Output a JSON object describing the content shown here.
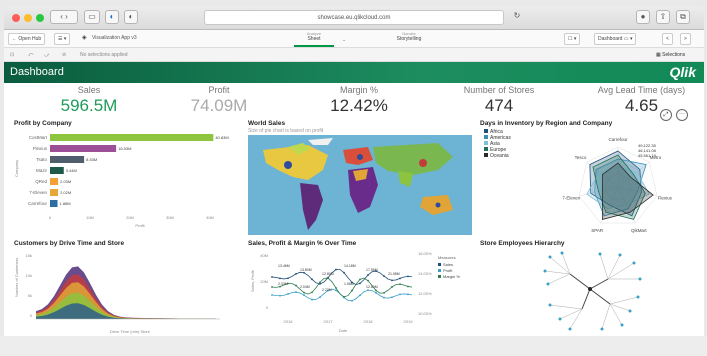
{
  "browser": {
    "url": "showcase.eu.qlikcloud.com"
  },
  "toolbar": {
    "open_hub": "Open Hub",
    "app_title": "Visualization App v3",
    "tab_analyze": "Analyze",
    "tab_sheet": "Sheet",
    "tab_narrate": "Narrate",
    "tab_storytelling": "Storytelling",
    "dashboard_btn": "Dashboard",
    "selections": "Selections",
    "no_selections": "No selections applied"
  },
  "header": {
    "title": "Dashboard",
    "logo": "Qlik"
  },
  "kpis": [
    {
      "label": "Sales",
      "value": "596.5M"
    },
    {
      "label": "Profit",
      "value": "74.09M"
    },
    {
      "label": "Margin %",
      "value": "12.42%"
    },
    {
      "label": "Number of Stores",
      "value": "474"
    },
    {
      "label": "Avg Lead Time (days)",
      "value": "4.65"
    }
  ],
  "panels": {
    "profit_by_company": "Profit by Company",
    "world_sales": "World Sales",
    "world_sub": "Size of pie chart is based on profit",
    "days_inventory": "Days in Inventory by Region and Company",
    "customers_drive": "Customers by Drive Time and Store",
    "sales_profit_margin": "Sales, Profit & Margin % Over Time",
    "store_employees": "Store Employees Hierarchy"
  },
  "chart_data": [
    {
      "type": "bar",
      "title": "Profit by Company",
      "ylabel": "Company",
      "xlabel": "Profit",
      "categories": [
        "CostMart",
        "Flexius",
        "Tsato",
        "Mazir",
        "QRed",
        "7-Eleven",
        "Carrefour"
      ],
      "values": [
        40.83,
        16.53,
        8.53,
        3.44,
        2.03,
        2.02,
        1.88
      ],
      "value_labels": [
        "40.83M",
        "16.53M",
        "8.53M",
        "3.44M",
        "2.03M",
        "2.02M",
        "1.88M"
      ],
      "colors": [
        "#8dc53e",
        "#9c4e96",
        "#4f5d6d",
        "#1e5a4c",
        "#f2a13a",
        "#e6a83b",
        "#2e6ca4"
      ],
      "xticks": [
        "0",
        "10M",
        "20M",
        "30M",
        "40M"
      ]
    },
    {
      "type": "line",
      "title": "Sales, Profit & Margin % Over Time",
      "xlabel": "Date",
      "ylabel": "Sales, Profit",
      "x": [
        "2016",
        "2017",
        "2018",
        "2019"
      ],
      "series": [
        {
          "name": "Sales"
        },
        {
          "name": "Profit"
        },
        {
          "name": "Margin %"
        }
      ],
      "y_ticks": [
        "40M",
        "20M",
        "0"
      ],
      "y2_ticks": [
        "16.00%",
        "14.00%",
        "12.00%",
        "10.00%"
      ],
      "legend_title": "Measures",
      "labels": [
        "13.46M",
        "13.80M",
        "12.80M",
        "14.18M",
        "17.56M",
        "21.08M",
        "2.33M",
        "2.04M",
        "2.22M",
        "1.56M",
        "12.60M"
      ]
    },
    {
      "type": "area",
      "title": "Customers by Drive Time and Store",
      "xlabel": "Drive Time (min) Store",
      "ylabel": "Number of Customers",
      "y_ticks": [
        "15k",
        "10k",
        "5k",
        "0"
      ]
    },
    {
      "type": "radar",
      "title": "Days in Inventory by Region and Company",
      "legend": [
        "Africa",
        "Americas",
        "Asia",
        "Europe",
        "Oceania"
      ],
      "axes": [
        "Carrefour",
        "Metro",
        "Flexius",
        "QikMart",
        "SPAR",
        "7-Eleven",
        "Tesco"
      ],
      "labels": [
        "49,122.35",
        "46,141.08",
        "45,561.19"
      ]
    }
  ],
  "colors": {
    "header": "#1d8d5f",
    "accent": "#009845",
    "kpi_green": "#1f9c5a"
  }
}
